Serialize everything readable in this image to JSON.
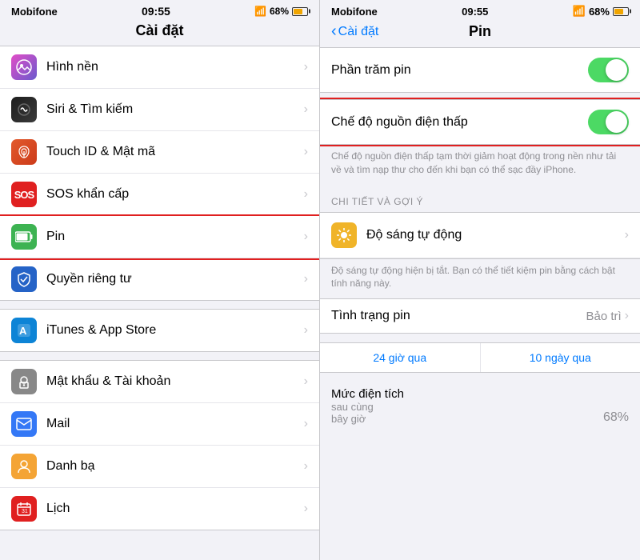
{
  "left": {
    "status": {
      "carrier": "Mobifone",
      "time": "09:55",
      "battery_pct": "68%"
    },
    "title": "Cài đặt",
    "items": [
      {
        "id": "wallpaper",
        "label": "Hình nền",
        "icon_class": "icon-wallpaper",
        "icon_char": "🌄"
      },
      {
        "id": "siri",
        "label": "Siri & Tìm kiếm",
        "icon_class": "icon-siri",
        "icon_char": "🔊"
      },
      {
        "id": "touchid",
        "label": "Touch ID & Mật mã",
        "icon_class": "icon-touchid",
        "icon_char": "👆"
      },
      {
        "id": "sos",
        "label": "SOS khẩn cấp",
        "icon_class": "icon-sos",
        "icon_char": "SOS"
      },
      {
        "id": "battery",
        "label": "Pin",
        "icon_class": "icon-battery",
        "icon_char": "🔋",
        "highlighted": true
      },
      {
        "id": "privacy",
        "label": "Quyền riêng tư",
        "icon_class": "icon-privacy",
        "icon_char": "✋"
      },
      {
        "id": "itunes",
        "label": "iTunes & App Store",
        "icon_class": "icon-itunes",
        "icon_char": "🅰"
      },
      {
        "id": "password",
        "label": "Mật khẩu & Tài khoản",
        "icon_class": "icon-password",
        "icon_char": "🔑"
      },
      {
        "id": "mail",
        "label": "Mail",
        "icon_class": "icon-mail",
        "icon_char": "✉"
      },
      {
        "id": "contacts",
        "label": "Danh bạ",
        "icon_class": "icon-contacts",
        "icon_char": "👤"
      },
      {
        "id": "calendar",
        "label": "Lịch",
        "icon_class": "icon-calendar",
        "icon_char": "📅"
      }
    ]
  },
  "right": {
    "status": {
      "carrier": "Mobifone",
      "time": "09:55",
      "battery_pct": "68%"
    },
    "back_label": "Cài đặt",
    "title": "Pin",
    "phan_tram_pin": "Phần trăm pin",
    "che_do": "Chế độ nguồn điện thấp",
    "che_do_desc": "Chế độ nguồn điện thấp tạm thời giảm hoạt động trong nền như tải về và tìm nạp thư cho đến khi bạn có thể sạc đầy iPhone.",
    "section_header": "CHI TIẾT VÀ GỢI Ý",
    "do_sang": "Độ sáng tự động",
    "do_sang_desc": "Độ sáng tự động hiện bị tắt. Bạn có thể tiết kiệm pin bằng cách bật tính năng này.",
    "tinh_trang_pin": "Tình trạng pin",
    "bao_tri": "Bảo trì",
    "tab_24h": "24 giờ qua",
    "tab_10d": "10 ngày qua",
    "muc_dien_tich": "Mức điện tích",
    "sau_cung": "sau cùng",
    "bay_gio": "bây giờ",
    "pct_value": "68%"
  }
}
